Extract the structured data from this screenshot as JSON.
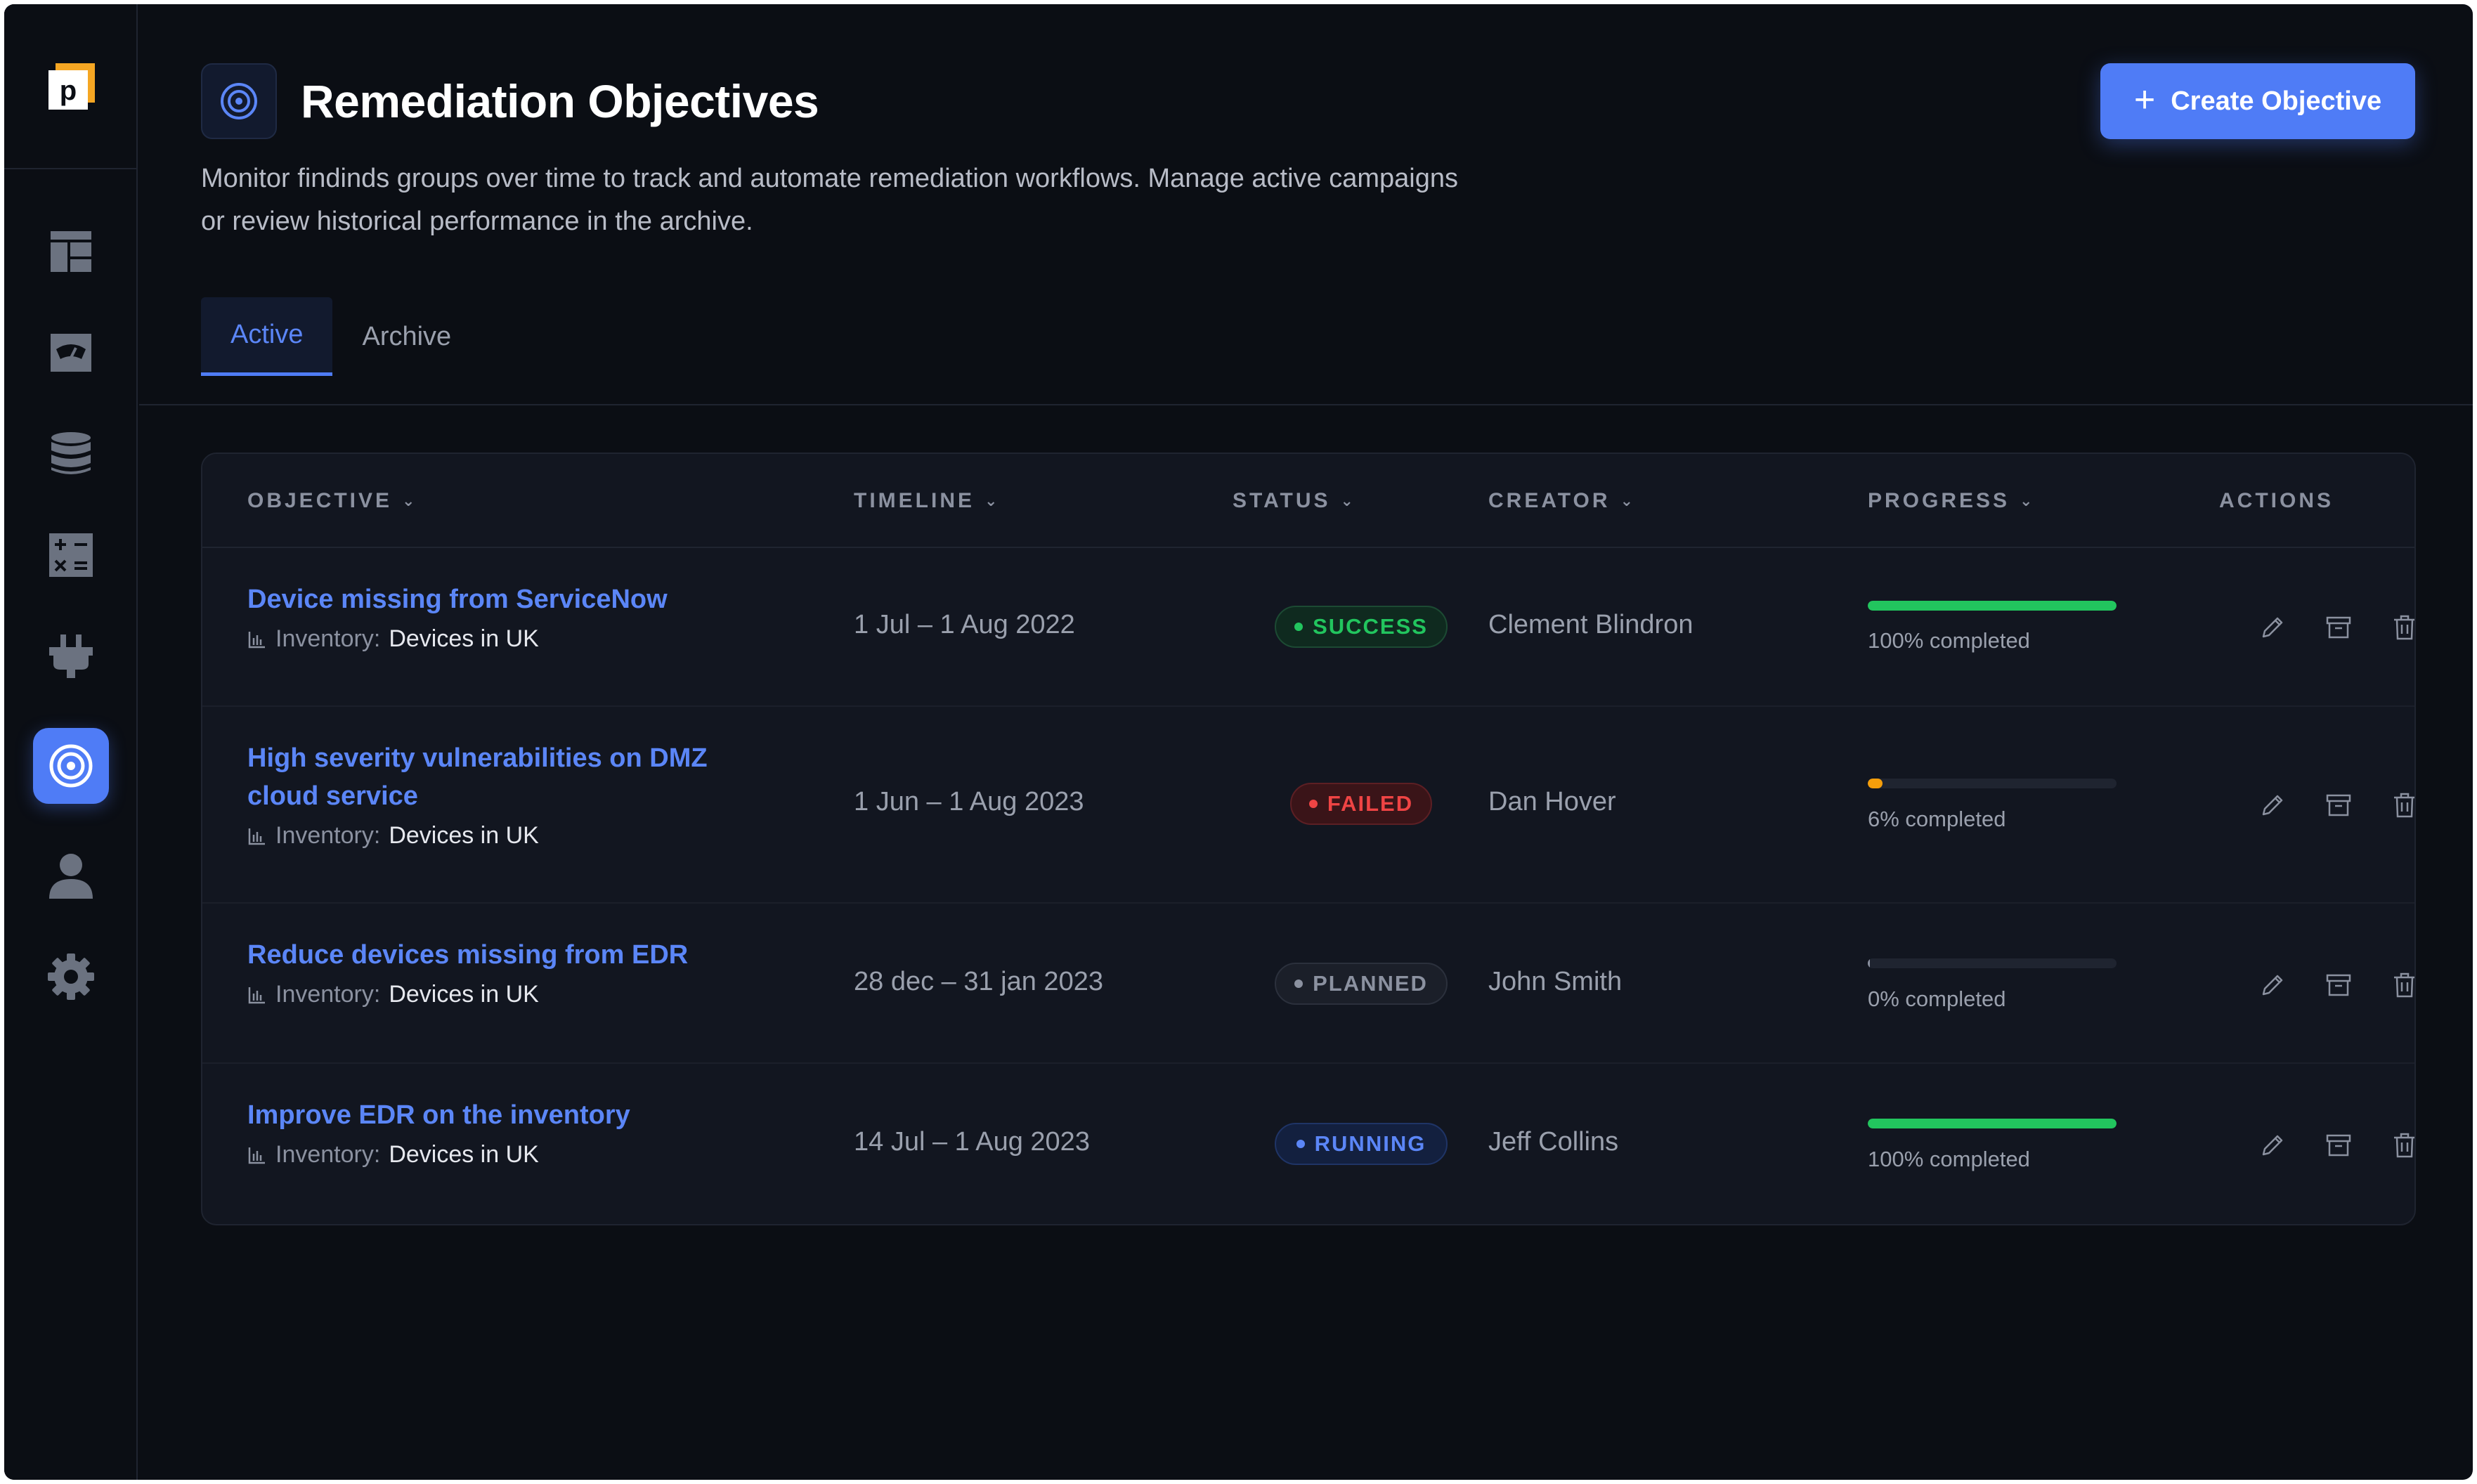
{
  "sidebar": {
    "logo_letter": "p",
    "items": [
      {
        "icon": "dashboard-icon"
      },
      {
        "icon": "gauge-icon"
      },
      {
        "icon": "database-icon"
      },
      {
        "icon": "calculator-icon"
      },
      {
        "icon": "plug-icon"
      },
      {
        "icon": "target-icon",
        "active": true
      },
      {
        "icon": "user-icon"
      },
      {
        "icon": "gear-icon"
      }
    ]
  },
  "header": {
    "title": "Remediation Objectives",
    "description": "Monitor findinds groups over time to track and automate remediation workflows. Manage active campaigns or review historical performance in the archive.",
    "create_button_label": "Create Objective",
    "tabs": [
      {
        "label": "Active",
        "active": true
      },
      {
        "label": "Archive",
        "active": false
      }
    ]
  },
  "table": {
    "columns": {
      "objective": "OBJECTIVE",
      "timeline": "TIMELINE",
      "status": "STATUS",
      "creator": "CREATOR",
      "progress": "PROGRESS",
      "actions": "ACTIONS"
    },
    "inventory_label": "Inventory:",
    "rows": [
      {
        "objective_line1": "Device missing from ServiceNow",
        "objective_line2": "",
        "inventory": "Devices in UK",
        "timeline": "1 Jul – 1 Aug 2022",
        "status": "SUCCESS",
        "creator": "Clement Blindron",
        "progress_value": 1.0,
        "progress_text": "100% completed"
      },
      {
        "objective_line1": "High severity vulnerabilities on DMZ",
        "objective_line2": "cloud service",
        "inventory": "Devices in UK",
        "timeline": "1 Jun – 1 Aug 2023",
        "status": "FAILED",
        "creator": "Dan Hover",
        "progress_value": 0.06,
        "progress_text": "6% completed"
      },
      {
        "objective_line1": "Reduce devices missing from EDR",
        "objective_line2": "",
        "inventory": "Devices in UK",
        "timeline": "28 dec – 31 jan 2023",
        "status": "PLANNED",
        "creator": "John Smith",
        "progress_value": 0.0,
        "progress_text": "0% completed"
      },
      {
        "objective_line1": "Improve EDR on the inventory",
        "objective_line2": "",
        "inventory": "Devices in UK",
        "timeline": "14 Jul – 1 Aug 2023",
        "status": "RUNNING",
        "creator": "Jeff Collins",
        "progress_value": 1.0,
        "progress_text": "100% completed"
      }
    ]
  },
  "colors": {
    "accent": "#4f7cf6",
    "success": "#22c55e",
    "failed": "#ef4444",
    "progress_partial": "#f59e0b",
    "background": "#0b0e14"
  }
}
